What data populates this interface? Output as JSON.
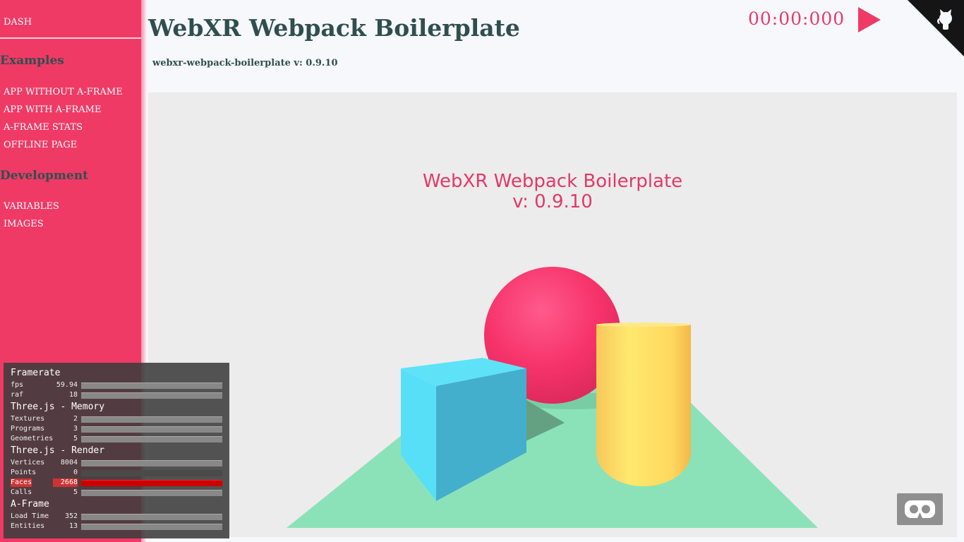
{
  "sidebar": {
    "dash_label": "DASH",
    "sections": [
      {
        "title": "Examples",
        "items": [
          "APP WITHOUT A-FRAME",
          "APP WITH A-FRAME",
          "A-FRAME STATS",
          "OFFLINE PAGE"
        ]
      },
      {
        "title": "Development",
        "items": [
          "VARIABLES",
          "IMAGES"
        ]
      }
    ]
  },
  "header": {
    "title": "WebXR Webpack Boilerplate",
    "version": "webxr-webpack-boilerplate v: 0.9.10",
    "timer": "00:00:000",
    "play_icon": "play-icon",
    "corner_icon": "github-octocat-icon"
  },
  "scene": {
    "title_line1": "WebXR Webpack Boilerplate",
    "title_line2": "v: 0.9.10",
    "vr_icon": "vr-goggles-icon",
    "colors": {
      "sphere": "#f6336a",
      "box": "#4fd4f0",
      "cylinder": "#ffe36a",
      "plane": "#8ce2b8",
      "title": "#e33867"
    }
  },
  "stats": {
    "groups": [
      {
        "title": "Framerate",
        "rows": [
          {
            "label": "fps",
            "value": "59.94"
          },
          {
            "label": "raf",
            "value": "18"
          }
        ]
      },
      {
        "title": "Three.js - Memory",
        "rows": [
          {
            "label": "Textures",
            "value": "2"
          },
          {
            "label": "Programs",
            "value": "3"
          },
          {
            "label": "Geometries",
            "value": "5"
          }
        ]
      },
      {
        "title": "Three.js - Render",
        "rows": [
          {
            "label": "Vertices",
            "value": "8004"
          },
          {
            "label": "Points",
            "value": "0"
          },
          {
            "label": "Faces",
            "value": "2668"
          },
          {
            "label": "Calls",
            "value": "5"
          }
        ]
      },
      {
        "title": "A-Frame",
        "rows": [
          {
            "label": "Load Time",
            "value": "352"
          },
          {
            "label": "Entities",
            "value": "13"
          }
        ]
      }
    ]
  },
  "colors": {
    "accent": "#f03a66",
    "heading": "#2f4f4f",
    "background": "#f7f8fc"
  }
}
